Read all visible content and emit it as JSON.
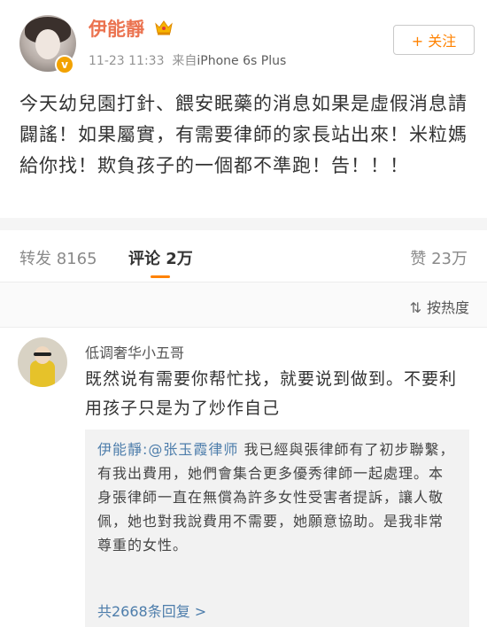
{
  "post": {
    "username": "伊能靜",
    "time": "11-23 11:33",
    "source_prefix": "来自",
    "device": "iPhone 6s Plus",
    "follow_label": "+ 关注",
    "verified_mark": "v",
    "body": "今天幼兒園打針、餵安眠藥的消息如果是虛假消息請闢謠！如果屬實，有需要律師的家長站出來！米粒媽給你找！欺負孩子的一個都不準跑！告！！！"
  },
  "tabs": {
    "repost": "转发 8165",
    "comment": "评论 2万",
    "like": "赞 23万"
  },
  "sort": {
    "label": "按热度",
    "icon": "sort-icon"
  },
  "comment": {
    "username": "低调奢华小五哥",
    "text": "既然说有需要你帮忙找，就要说到做到。不要利用孩子只是为了炒作自己",
    "reply": {
      "author": "伊能靜:",
      "mention": "@张玉霞律师",
      "text": " 我已經與張律師有了初步聯繫，有我出費用，她們會集合更多優秀律師一起處理。本身張律師一直在無償為許多女性受害者提訴，讓人敬佩，她也對我說費用不需要，她願意協助。是我非常尊重的女性。"
    },
    "more_replies": "共2668条回复 >"
  },
  "colors": {
    "username": "#eb7350",
    "accent": "#ff8200",
    "link": "#4d7dab"
  }
}
